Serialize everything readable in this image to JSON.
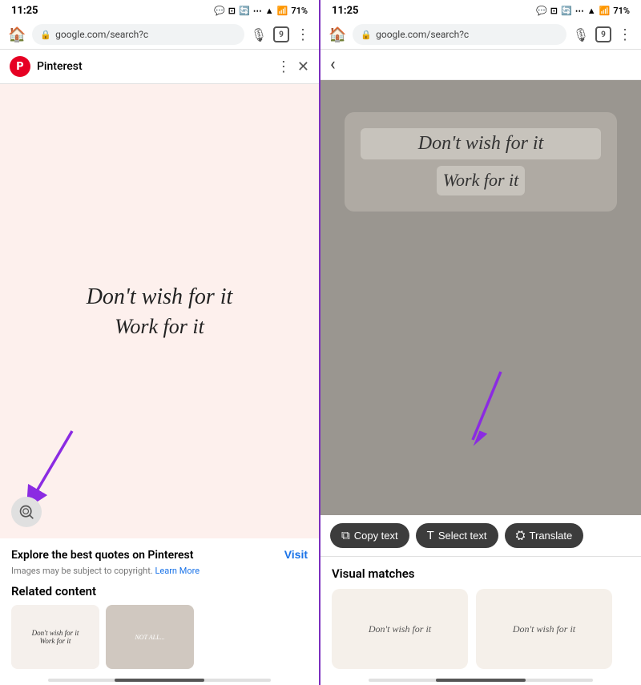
{
  "left_panel": {
    "status": {
      "time": "11:25",
      "battery": "71%",
      "signal_icon": "📶"
    },
    "browser": {
      "url": "google.com/search?c",
      "tab_count": "9"
    },
    "pinterest_banner": {
      "title": "Pinterest",
      "visit_label": "Visit"
    },
    "image": {
      "quote_line1": "Don't wish for it",
      "quote_line2": "Work for it"
    },
    "explore": {
      "title": "Explore the best quotes on Pinterest",
      "copyright": "Images may be subject to copyright.",
      "learn_more": "Learn More"
    },
    "related": {
      "title": "Related content"
    },
    "arrow": {
      "color": "#8B2BE2"
    }
  },
  "right_panel": {
    "status": {
      "time": "11:25",
      "battery": "71%"
    },
    "browser": {
      "url": "google.com/search?c",
      "tab_count": "9"
    },
    "lens": {
      "quote_line1": "Don't wish for it",
      "quote_line2": "Work for it"
    },
    "action_bar": {
      "copy_text_label": "Copy text",
      "select_text_label": "Select text",
      "translate_label": "Translate",
      "copy_icon": "⧉",
      "text_icon": "T",
      "translate_icon": "⛭"
    },
    "visual_matches": {
      "title": "Visual matches",
      "match1_text": "Don't wish for it",
      "match2_text": "Don't wish for it"
    }
  }
}
